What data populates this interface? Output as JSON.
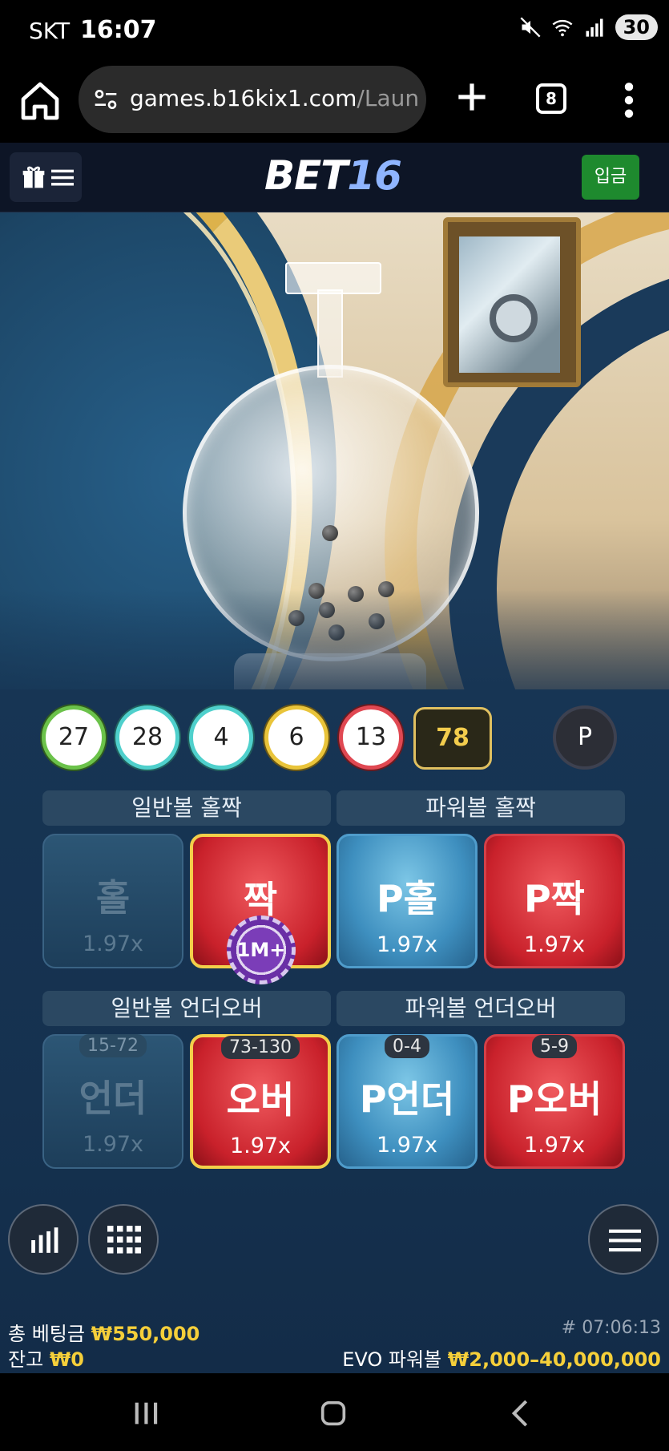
{
  "status": {
    "carrier": "SKT",
    "time": "16:07",
    "battery": "30"
  },
  "browser": {
    "url_host": "games.b16kix1.com",
    "url_path": "/Launch",
    "tab_count": "8"
  },
  "header": {
    "logo_text": "BET",
    "logo_num": "16",
    "deposit_label": "입금"
  },
  "results": {
    "balls": [
      {
        "num": "27",
        "color": "green"
      },
      {
        "num": "28",
        "color": "teal"
      },
      {
        "num": "4",
        "color": "teal"
      },
      {
        "num": "6",
        "color": "yellow"
      },
      {
        "num": "13",
        "color": "red"
      }
    ],
    "sum": "78",
    "powerball": "P"
  },
  "sections": {
    "normal_oddeven": "일반볼 홀짝",
    "power_oddeven": "파워볼 홀짝",
    "normal_underover": "일반볼 언더오버",
    "power_underover": "파워볼 언더오버"
  },
  "bets": {
    "odd": {
      "label": "홀",
      "odds": "1.97x"
    },
    "even": {
      "label": "짝",
      "odds": "1.97x",
      "chip": "1M+"
    },
    "p_odd": {
      "label": "P홀",
      "odds": "1.97x"
    },
    "p_even": {
      "label": "P짝",
      "odds": "1.97x"
    },
    "under": {
      "label": "언더",
      "odds": "1.97x",
      "range": "15-72"
    },
    "over": {
      "label": "오버",
      "odds": "1.97x",
      "range": "73-130"
    },
    "p_under": {
      "label": "P언더",
      "odds": "1.97x",
      "range": "0-4"
    },
    "p_over": {
      "label": "P오버",
      "odds": "1.97x",
      "range": "5-9"
    }
  },
  "footer": {
    "total_bet_label": "총 베팅금",
    "total_bet_value": "₩550,000",
    "balance_label": "잔고",
    "balance_value": "₩0",
    "round_id": "# 07:06:13",
    "game_name": "EVO 파워볼",
    "limits": "₩2,000–40,000,000"
  },
  "colors": {
    "accent_gold": "#f5cf3a",
    "deposit_green": "#1e8a2e",
    "bet_red": "#c9212b",
    "bet_blue": "#3e8fbf"
  }
}
